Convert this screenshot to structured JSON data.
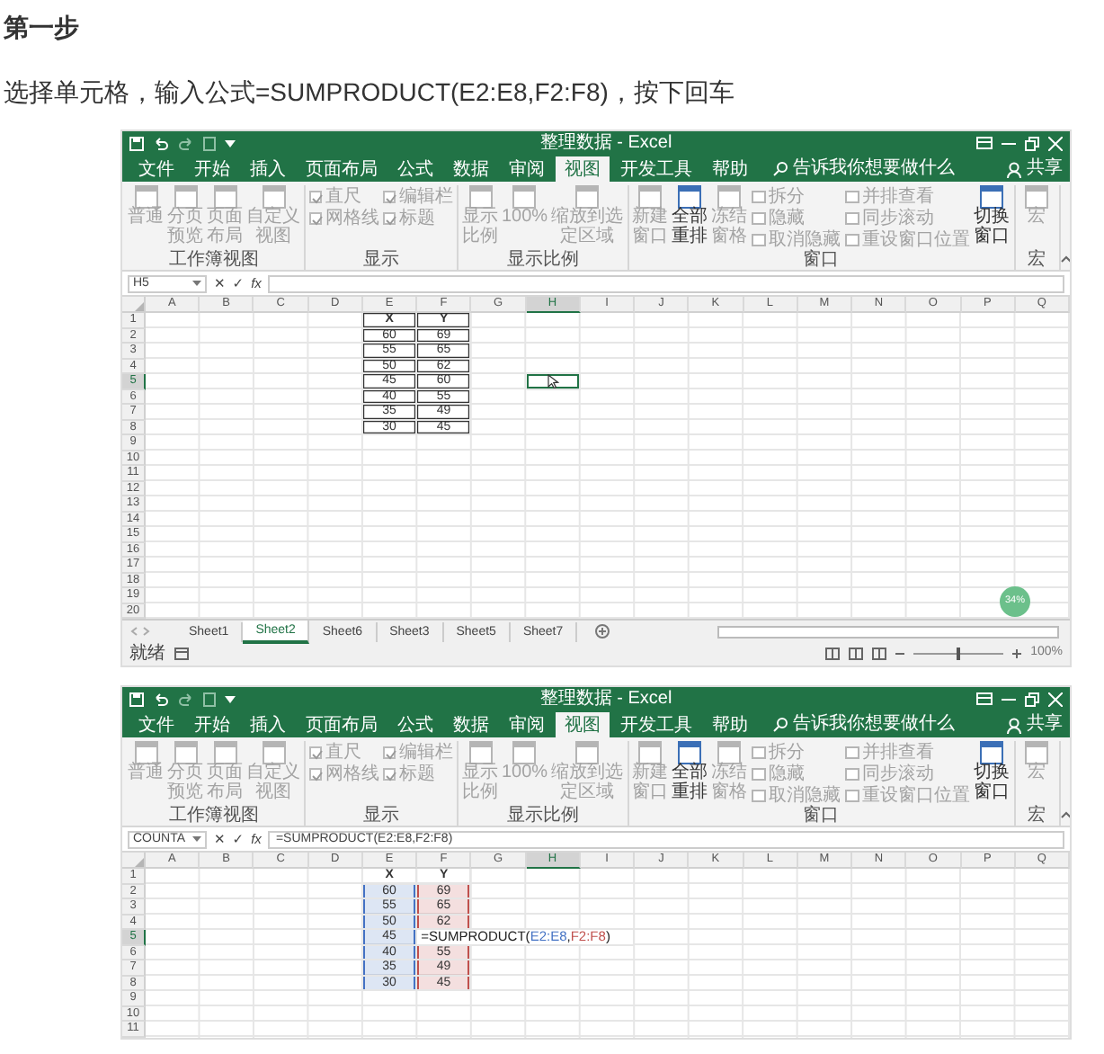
{
  "heading": "第一步",
  "instruction": "选择单元格，输入公式=SUMPRODUCT(E2:E8,F2:F8)，按下回车",
  "screenshots": [
    {
      "title": "整理数据 - Excel",
      "ribbon_tabs": [
        {
          "label": "文件",
          "selected": false
        },
        {
          "label": "开始",
          "selected": false
        },
        {
          "label": "插入",
          "selected": false
        },
        {
          "label": "页面布局",
          "selected": false
        },
        {
          "label": "公式",
          "selected": false
        },
        {
          "label": "数据",
          "selected": false
        },
        {
          "label": "审阅",
          "selected": false
        },
        {
          "label": "视图",
          "selected": true
        },
        {
          "label": "开发工具",
          "selected": false
        },
        {
          "label": "帮助",
          "selected": false
        }
      ],
      "search_hint": "告诉我你想要做什么",
      "share": "共享",
      "ribbon_groups": [
        {
          "label": "工作簿视图",
          "items": [
            {
              "kind": "large",
              "label": "普通",
              "disabled": true
            },
            {
              "kind": "large",
              "label": "分页预览",
              "disabled": true
            },
            {
              "kind": "large",
              "label": "页面布局",
              "disabled": true
            },
            {
              "kind": "large",
              "label": "自定义视图",
              "disabled": true
            }
          ]
        },
        {
          "label": "显示",
          "items": [
            {
              "kind": "checks",
              "items": [
                {
                  "label": "直尺",
                  "checked": true,
                  "disabled": true
                },
                {
                  "label": "网格线",
                  "checked": true,
                  "disabled": true
                }
              ]
            },
            {
              "kind": "checks",
              "items": [
                {
                  "label": "编辑栏",
                  "checked": true,
                  "disabled": true
                },
                {
                  "label": "标题",
                  "checked": true,
                  "disabled": true
                }
              ]
            }
          ]
        },
        {
          "label": "显示比例",
          "items": [
            {
              "kind": "large",
              "label": "显示比例",
              "disabled": true
            },
            {
              "kind": "large",
              "label": "100%",
              "disabled": true
            },
            {
              "kind": "large",
              "label": "缩放到选定区域",
              "disabled": true
            }
          ]
        },
        {
          "label": "窗口",
          "items": [
            {
              "kind": "large",
              "label": "新建窗口",
              "disabled": true
            },
            {
              "kind": "large",
              "label": "全部重排",
              "disabled": false
            },
            {
              "kind": "large",
              "label": "冻结窗格",
              "disabled": true
            },
            {
              "kind": "stack",
              "items": [
                {
                  "label": "拆分",
                  "disabled": true
                },
                {
                  "label": "隐藏",
                  "disabled": true
                },
                {
                  "label": "取消隐藏",
                  "disabled": true
                }
              ]
            },
            {
              "kind": "stack",
              "items": [
                {
                  "label": "并排查看",
                  "disabled": true
                },
                {
                  "label": "同步滚动",
                  "disabled": true
                },
                {
                  "label": "重设窗口位置",
                  "disabled": true
                }
              ]
            },
            {
              "kind": "large",
              "label": "切换窗口",
              "disabled": false
            }
          ]
        },
        {
          "label": "宏",
          "items": [
            {
              "kind": "large",
              "label": "宏",
              "disabled": true
            }
          ]
        }
      ],
      "formula_bar": {
        "name_box": "H5",
        "cancel": "✕",
        "enter": "✓",
        "function": "fx"
      },
      "columns": [
        {
          "label": "A",
          "selected": false
        },
        {
          "label": "B",
          "selected": false
        },
        {
          "label": "C",
          "selected": false
        },
        {
          "label": "D",
          "selected": false
        },
        {
          "label": "E",
          "selected": false
        },
        {
          "label": "F",
          "selected": false
        },
        {
          "label": "G",
          "selected": false
        },
        {
          "label": "H",
          "selected": true
        },
        {
          "label": "I",
          "selected": false
        },
        {
          "label": "J",
          "selected": false
        },
        {
          "label": "K",
          "selected": false
        },
        {
          "label": "L",
          "selected": false
        },
        {
          "label": "M",
          "selected": false
        },
        {
          "label": "N",
          "selected": false
        },
        {
          "label": "O",
          "selected": false
        },
        {
          "label": "P",
          "selected": false
        },
        {
          "label": "Q",
          "selected": false
        }
      ],
      "rows": [
        {
          "header": "1",
          "selected": false,
          "E": {
            "text": "X",
            "bold": true,
            "bordered": true
          },
          "F": {
            "text": "Y",
            "bold": true,
            "bordered": true
          }
        },
        {
          "header": "2",
          "selected": false,
          "E": {
            "text": "60",
            "bordered": true
          },
          "F": {
            "text": "69",
            "bordered": true
          }
        },
        {
          "header": "3",
          "selected": false,
          "E": {
            "text": "55",
            "bordered": true
          },
          "F": {
            "text": "65",
            "bordered": true
          }
        },
        {
          "header": "4",
          "selected": false,
          "E": {
            "text": "50",
            "bordered": true
          },
          "F": {
            "text": "62",
            "bordered": true
          }
        },
        {
          "header": "5",
          "selected": true,
          "E": {
            "text": "45",
            "bordered": true
          },
          "F": {
            "text": "60",
            "bordered": true
          }
        },
        {
          "header": "6",
          "selected": false,
          "E": {
            "text": "40",
            "bordered": true
          },
          "F": {
            "text": "55",
            "bordered": true
          }
        },
        {
          "header": "7",
          "selected": false,
          "E": {
            "text": "35",
            "bordered": true
          },
          "F": {
            "text": "49",
            "bordered": true
          }
        },
        {
          "header": "8",
          "selected": false,
          "E": {
            "text": "30",
            "bordered": true
          },
          "F": {
            "text": "45",
            "bordered": true
          }
        },
        {
          "header": "9",
          "selected": false
        },
        {
          "header": "10",
          "selected": false
        },
        {
          "header": "11",
          "selected": false
        },
        {
          "header": "12",
          "selected": false
        },
        {
          "header": "13",
          "selected": false
        },
        {
          "header": "14",
          "selected": false
        },
        {
          "header": "15",
          "selected": false
        },
        {
          "header": "16",
          "selected": false
        },
        {
          "header": "17",
          "selected": false
        },
        {
          "header": "18",
          "selected": false
        },
        {
          "header": "19",
          "selected": false
        },
        {
          "header": "20",
          "selected": false
        }
      ],
      "widget": "34%",
      "sheet_tabs": [
        {
          "label": "Sheet1",
          "selected": false
        },
        {
          "label": "Sheet2",
          "selected": true
        },
        {
          "label": "Sheet6",
          "selected": false
        },
        {
          "label": "Sheet3",
          "selected": false
        },
        {
          "label": "Sheet5",
          "selected": false
        },
        {
          "label": "Sheet7",
          "selected": false
        }
      ],
      "status": {
        "text": "就绪",
        "level": 0.5,
        "zoom": "100%"
      }
    },
    {
      "title": "整理数据 - Excel",
      "ribbon_tabs": [
        {
          "label": "文件",
          "selected": false
        },
        {
          "label": "开始",
          "selected": false
        },
        {
          "label": "插入",
          "selected": false
        },
        {
          "label": "页面布局",
          "selected": false
        },
        {
          "label": "公式",
          "selected": false
        },
        {
          "label": "数据",
          "selected": false
        },
        {
          "label": "审阅",
          "selected": false
        },
        {
          "label": "视图",
          "selected": true
        },
        {
          "label": "开发工具",
          "selected": false
        },
        {
          "label": "帮助",
          "selected": false
        }
      ],
      "search_hint": "告诉我你想要做什么",
      "share": "共享",
      "ribbon_groups": [
        {
          "label": "工作簿视图",
          "items": [
            {
              "kind": "large",
              "label": "普通",
              "disabled": true
            },
            {
              "kind": "large",
              "label": "分页预览",
              "disabled": true
            },
            {
              "kind": "large",
              "label": "页面布局",
              "disabled": true
            },
            {
              "kind": "large",
              "label": "自定义视图",
              "disabled": true
            }
          ]
        },
        {
          "label": "显示",
          "items": [
            {
              "kind": "checks",
              "items": [
                {
                  "label": "直尺",
                  "checked": true,
                  "disabled": true
                },
                {
                  "label": "网格线",
                  "checked": true,
                  "disabled": true
                }
              ]
            },
            {
              "kind": "checks",
              "items": [
                {
                  "label": "编辑栏",
                  "checked": true,
                  "disabled": true
                },
                {
                  "label": "标题",
                  "checked": true,
                  "disabled": true
                }
              ]
            }
          ]
        },
        {
          "label": "显示比例",
          "items": [
            {
              "kind": "large",
              "label": "显示比例",
              "disabled": true
            },
            {
              "kind": "large",
              "label": "100%",
              "disabled": true
            },
            {
              "kind": "large",
              "label": "缩放到选定区域",
              "disabled": true
            }
          ]
        },
        {
          "label": "窗口",
          "items": [
            {
              "kind": "large",
              "label": "新建窗口",
              "disabled": true
            },
            {
              "kind": "large",
              "label": "全部重排",
              "disabled": false
            },
            {
              "kind": "large",
              "label": "冻结窗格",
              "disabled": true
            },
            {
              "kind": "stack",
              "items": [
                {
                  "label": "拆分",
                  "disabled": true
                },
                {
                  "label": "隐藏",
                  "disabled": true
                },
                {
                  "label": "取消隐藏",
                  "disabled": true
                }
              ]
            },
            {
              "kind": "stack",
              "items": [
                {
                  "label": "并排查看",
                  "disabled": true
                },
                {
                  "label": "同步滚动",
                  "disabled": true
                },
                {
                  "label": "重设窗口位置",
                  "disabled": true
                }
              ]
            },
            {
              "kind": "large",
              "label": "切换窗口",
              "disabled": false
            }
          ]
        },
        {
          "label": "宏",
          "items": [
            {
              "kind": "large",
              "label": "宏",
              "disabled": true
            }
          ]
        }
      ],
      "formula_bar": {
        "name_box": "COUNTA",
        "cancel": "✕",
        "enter": "✓",
        "function": "fx",
        "formula": "=SUMPRODUCT(E2:E8,F2:F8)"
      },
      "columns": [
        {
          "label": "A",
          "selected": false
        },
        {
          "label": "B",
          "selected": false
        },
        {
          "label": "C",
          "selected": false
        },
        {
          "label": "D",
          "selected": false
        },
        {
          "label": "E",
          "selected": false
        },
        {
          "label": "F",
          "selected": false
        },
        {
          "label": "G",
          "selected": false
        },
        {
          "label": "H",
          "selected": true
        },
        {
          "label": "I",
          "selected": false
        },
        {
          "label": "J",
          "selected": false
        },
        {
          "label": "K",
          "selected": false
        },
        {
          "label": "L",
          "selected": false
        },
        {
          "label": "M",
          "selected": false
        },
        {
          "label": "N",
          "selected": false
        },
        {
          "label": "O",
          "selected": false
        },
        {
          "label": "P",
          "selected": false
        },
        {
          "label": "Q",
          "selected": false
        }
      ],
      "rows": [
        {
          "header": "1",
          "selected": false,
          "E": {
            "text": "X",
            "bold": true
          },
          "F": {
            "text": "Y",
            "bold": true
          }
        },
        {
          "header": "2",
          "selected": false,
          "E": {
            "text": "60",
            "color": "#4472c4"
          },
          "F": {
            "text": "69",
            "color": "#c0504d"
          }
        },
        {
          "header": "3",
          "selected": false,
          "E": {
            "text": "55",
            "color": "#4472c4"
          },
          "F": {
            "text": "65",
            "color": "#c0504d"
          }
        },
        {
          "header": "4",
          "selected": false,
          "E": {
            "text": "50",
            "color": "#4472c4"
          },
          "F": {
            "text": "62",
            "color": "#c0504d"
          }
        },
        {
          "header": "5",
          "selected": true,
          "E": {
            "text": "45",
            "color": "#4472c4"
          },
          "editor": [
            {
              "text": "=SUMPRODUCT("
            },
            {
              "text": "E2:E8",
              "color": "#4472c4"
            },
            {
              "text": ","
            },
            {
              "text": "F2:F8",
              "color": "#c0504d"
            },
            {
              "text": ")"
            }
          ]
        },
        {
          "header": "6",
          "selected": false,
          "E": {
            "text": "40",
            "color": "#4472c4"
          },
          "F": {
            "text": "55",
            "color": "#c0504d"
          }
        },
        {
          "header": "7",
          "selected": false,
          "E": {
            "text": "35",
            "color": "#4472c4"
          },
          "F": {
            "text": "49",
            "color": "#c0504d"
          }
        },
        {
          "header": "8",
          "selected": false,
          "E": {
            "text": "30",
            "color": "#4472c4"
          },
          "F": {
            "text": "45",
            "color": "#c0504d"
          }
        },
        {
          "header": "9",
          "selected": false
        },
        {
          "header": "10",
          "selected": false
        },
        {
          "header": "11",
          "selected": false
        }
      ]
    }
  ]
}
